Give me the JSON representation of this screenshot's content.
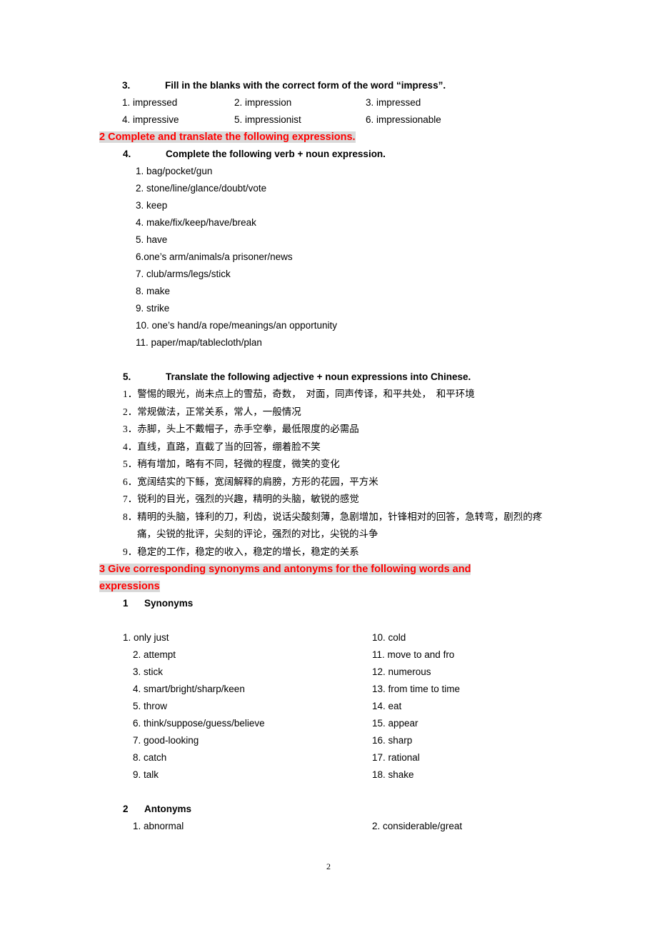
{
  "document": {
    "page_number": "2",
    "accent_red": "#ff0000",
    "highlight_gray": "#d9d9d9"
  },
  "section_impress": {
    "heading_num": "3.",
    "heading_text": "Fill in the blanks with the correct form of the word “impress”.",
    "answers": [
      [
        "1. impressed",
        "2. impression",
        "3. impressed"
      ],
      [
        "4. impressive",
        "5. impressionist",
        "6. impressionable"
      ]
    ]
  },
  "heading2": {
    "text": "2 Complete and translate the following expressions."
  },
  "section_verb_noun": {
    "heading_num": "4.",
    "heading_text": "Complete the following verb + noun expression.",
    "items": [
      "1. bag/pocket/gun",
      "2. stone/line/glance/doubt/vote",
      "3. keep",
      "4. make/fix/keep/have/break",
      "5. have",
      "6.one’s arm/animals/a prisoner/news",
      "7. club/arms/legs/stick",
      "8. make",
      "9. strike",
      "10. one’s hand/a rope/meanings/an opportunity",
      "11. paper/map/tablecloth/plan"
    ]
  },
  "section_translate": {
    "heading_num": "5.",
    "heading_text": "Translate the following adjective + noun expressions into Chinese.",
    "items": [
      "1．警惕的眼光，尚未点上的雪茄，奇数，　对面，同声传译，和平共处，　和平环境",
      "2．常规做法，正常关系，常人，一般情况",
      "3．赤脚，头上不戴帽子，赤手空拳，最低限度的必需品",
      "4．直线，直路，直截了当的回答，绷着脸不笑",
      "5．稍有增加，略有不同，轻微的程度，微笑的变化",
      "6．宽阔结实的下鲧，宽阔解释的肩膀，方形的花园，平方米",
      "7．锐利的目光，强烈的兴趣，精明的头脑，敏锐的感觉",
      "8．精明的头脑，锋利的刀，利齿，说话尖酸刻薄，急剧增加，针锋相对的回答，急转弯，剧烈的疼痛，尖锐的批评，尖刻的评论，强烈的对比，尖锐的斗争",
      "9．稳定的工作，稳定的收入，稳定的增长，稳定的关系"
    ]
  },
  "heading3": {
    "line1": "3  Give  corresponding  synonyms  and  antonyms  for  the  following  words  and",
    "line2": "expressions",
    "full_text": "3 Give corresponding synonyms and antonyms for the following words and expressions"
  },
  "synonyms": {
    "heading_num": "1",
    "heading_text": "Synonyms",
    "rows": [
      {
        "left": "1. only just",
        "right": "10. cold"
      },
      {
        "left": "2. attempt",
        "right": "11. move to and fro"
      },
      {
        "left": "3. stick",
        "right": "12. numerous"
      },
      {
        "left": "4. smart/bright/sharp/keen",
        "right": "13. from time to time"
      },
      {
        "left": "5. throw",
        "right": "14. eat"
      },
      {
        "left": "6. think/suppose/guess/believe",
        "right": "15. appear"
      },
      {
        "left": "7. good-looking",
        "right": "16. sharp"
      },
      {
        "left": "8. catch",
        "right": "17. rational"
      },
      {
        "left": "9. talk",
        "right": "18. shake"
      }
    ]
  },
  "antonyms": {
    "heading_num": "2",
    "heading_text": "Antonyms",
    "rows": [
      {
        "left": "1. abnormal",
        "right": "2. considerable/great"
      }
    ]
  }
}
